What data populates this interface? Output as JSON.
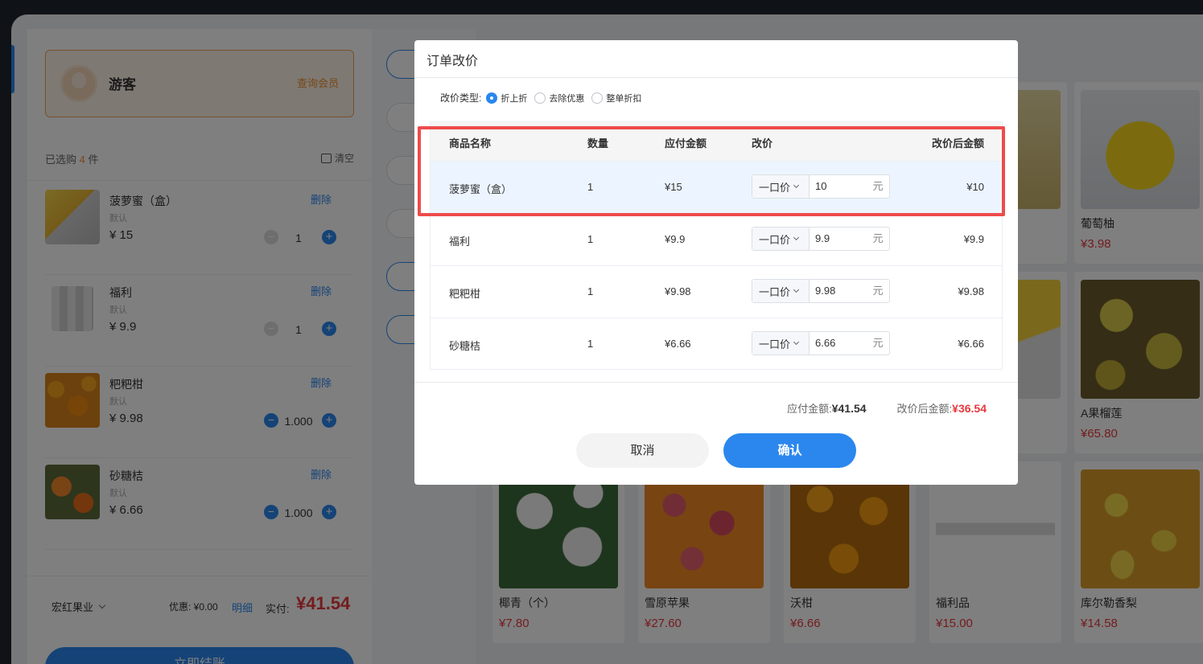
{
  "cart": {
    "member_name": "游客",
    "member_query": "查询会员",
    "selected_prefix": "已选购",
    "selected_count": "4",
    "selected_suffix": "件",
    "clear_label": "清空",
    "items": [
      {
        "name": "菠萝蜜（盒）",
        "spec": "默认",
        "price": "¥ 15",
        "qty": "1",
        "delete": "删除"
      },
      {
        "name": "福利",
        "spec": "默认",
        "price": "¥ 9.9",
        "qty": "1",
        "delete": "删除"
      },
      {
        "name": "粑粑柑",
        "spec": "默认",
        "price": "¥ 9.98",
        "qty": "1.000",
        "delete": "删除"
      },
      {
        "name": "砂糖桔",
        "spec": "默认",
        "price": "¥ 6.66",
        "qty": "1.000",
        "delete": "删除"
      }
    ],
    "store": "宏红果业",
    "discount": "优惠: ¥0.00",
    "detail": "明细",
    "paid_label": "实付:",
    "paid_value": "¥41.54",
    "checkout": "立即结账"
  },
  "products": [
    {
      "name": "葡萄柚",
      "price": "¥3.98"
    },
    {
      "name": "A果榴莲",
      "price": "¥65.80"
    },
    {
      "name": "椰青（个）",
      "price": "¥7.80"
    },
    {
      "name": "雪原苹果",
      "price": "¥27.60"
    },
    {
      "name": "沃柑",
      "price": "¥6.66"
    },
    {
      "name": "福利品",
      "price": "¥15.00"
    },
    {
      "name": "库尔勒香梨",
      "price": "¥14.58"
    }
  ],
  "modal": {
    "title": "订单改价",
    "type_label": "改价类型:",
    "types": [
      "折上折",
      "去除优惠",
      "整单折扣"
    ],
    "headers": {
      "name": "商品名称",
      "qty": "数量",
      "due": "应付金额",
      "change": "改价",
      "after": "改价后金额"
    },
    "rows": [
      {
        "name": "菠萝蜜（盒）",
        "qty": "1",
        "due": "¥15",
        "mode": "一口价",
        "value": "10",
        "unit": "元",
        "after": "¥10"
      },
      {
        "name": "福利",
        "qty": "1",
        "due": "¥9.9",
        "mode": "一口价",
        "value": "9.9",
        "unit": "元",
        "after": "¥9.9"
      },
      {
        "name": "粑粑柑",
        "qty": "1",
        "due": "¥9.98",
        "mode": "一口价",
        "value": "9.98",
        "unit": "元",
        "after": "¥9.98"
      },
      {
        "name": "砂糖桔",
        "qty": "1",
        "due": "¥6.66",
        "mode": "一口价",
        "value": "6.66",
        "unit": "元",
        "after": "¥6.66"
      }
    ],
    "due_label": "应付金额:",
    "due_value": "¥41.54",
    "after_label": "改价后金额:",
    "after_value": "¥36.54",
    "cancel": "取消",
    "confirm": "确认"
  }
}
